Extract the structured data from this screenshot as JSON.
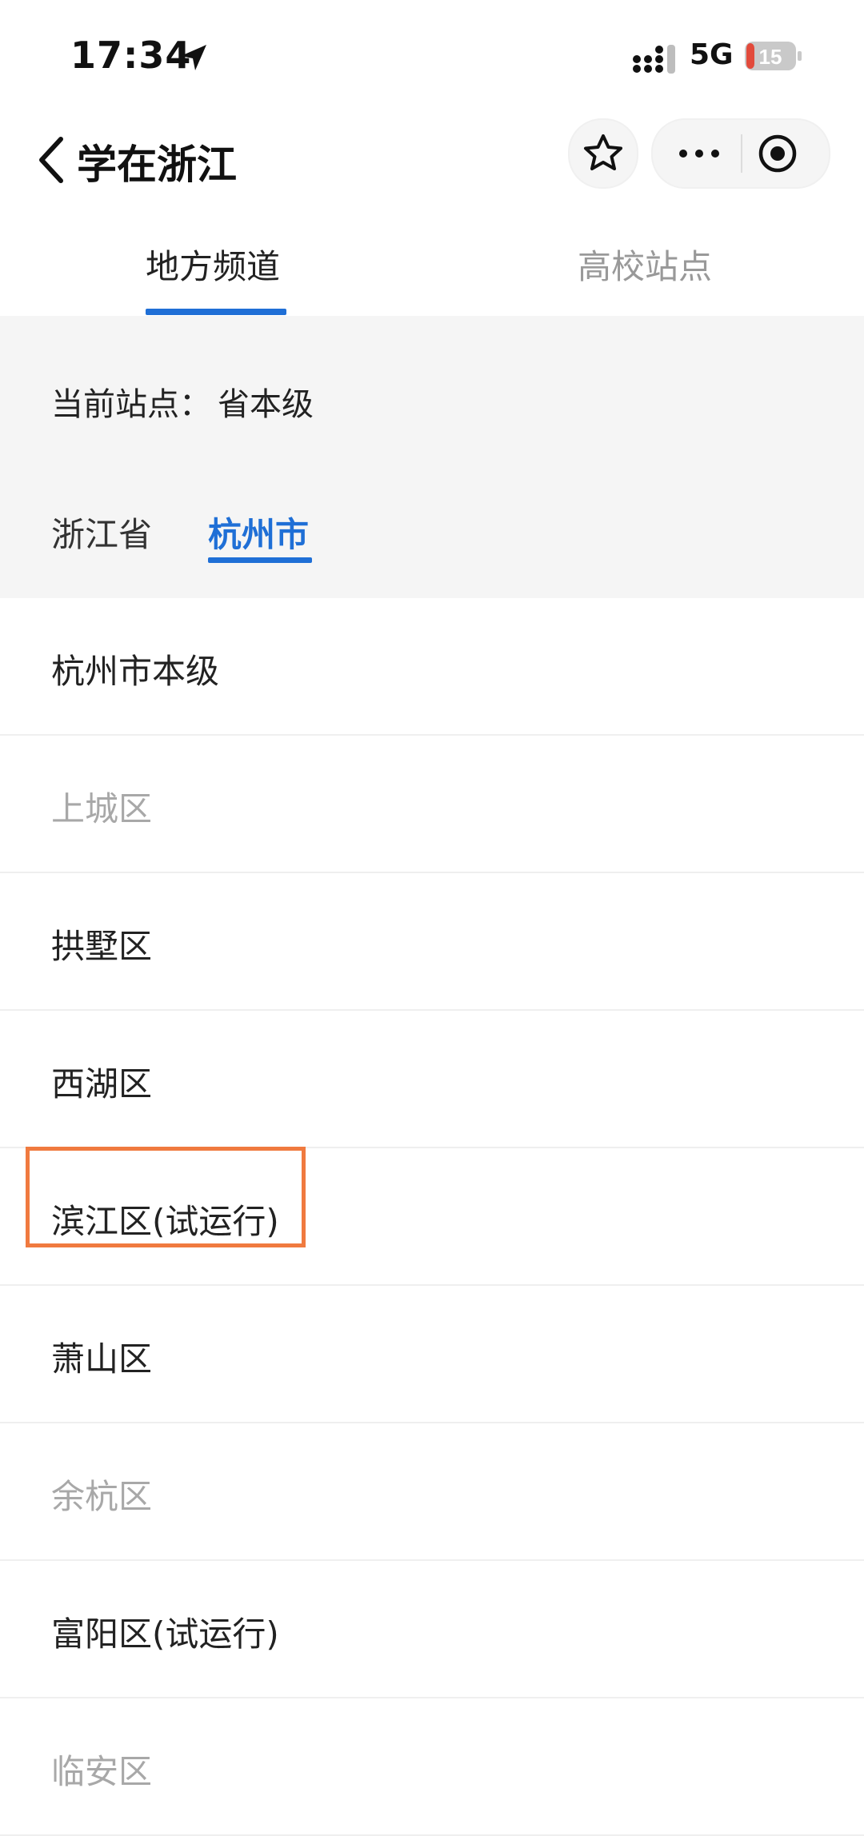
{
  "status_bar": {
    "time": "17:34",
    "network": "5G",
    "battery": "15"
  },
  "titlebar": {
    "title": "学在浙江"
  },
  "main_tabs": [
    {
      "label": "地方频道",
      "active": true
    },
    {
      "label": "高校站点",
      "active": false
    }
  ],
  "panel": {
    "current_site_label": "当前站点：",
    "current_site_value": "省本级",
    "sub_tabs": [
      {
        "label": "浙江省",
        "active": false
      },
      {
        "label": "杭州市",
        "active": true
      }
    ]
  },
  "list": [
    {
      "label": "杭州市本级",
      "enabled": true
    },
    {
      "label": "上城区",
      "enabled": false
    },
    {
      "label": "拱墅区",
      "enabled": true
    },
    {
      "label": "西湖区",
      "enabled": true
    },
    {
      "label": "滨江区(试运行)",
      "enabled": true,
      "highlighted": true
    },
    {
      "label": "萧山区",
      "enabled": true
    },
    {
      "label": "余杭区",
      "enabled": false
    },
    {
      "label": "富阳区(试运行)",
      "enabled": true
    },
    {
      "label": "临安区",
      "enabled": false
    }
  ],
  "colors": {
    "accent": "#1f6fd6",
    "highlight": "#f07a3f",
    "battery_low": "#e24a3b"
  }
}
